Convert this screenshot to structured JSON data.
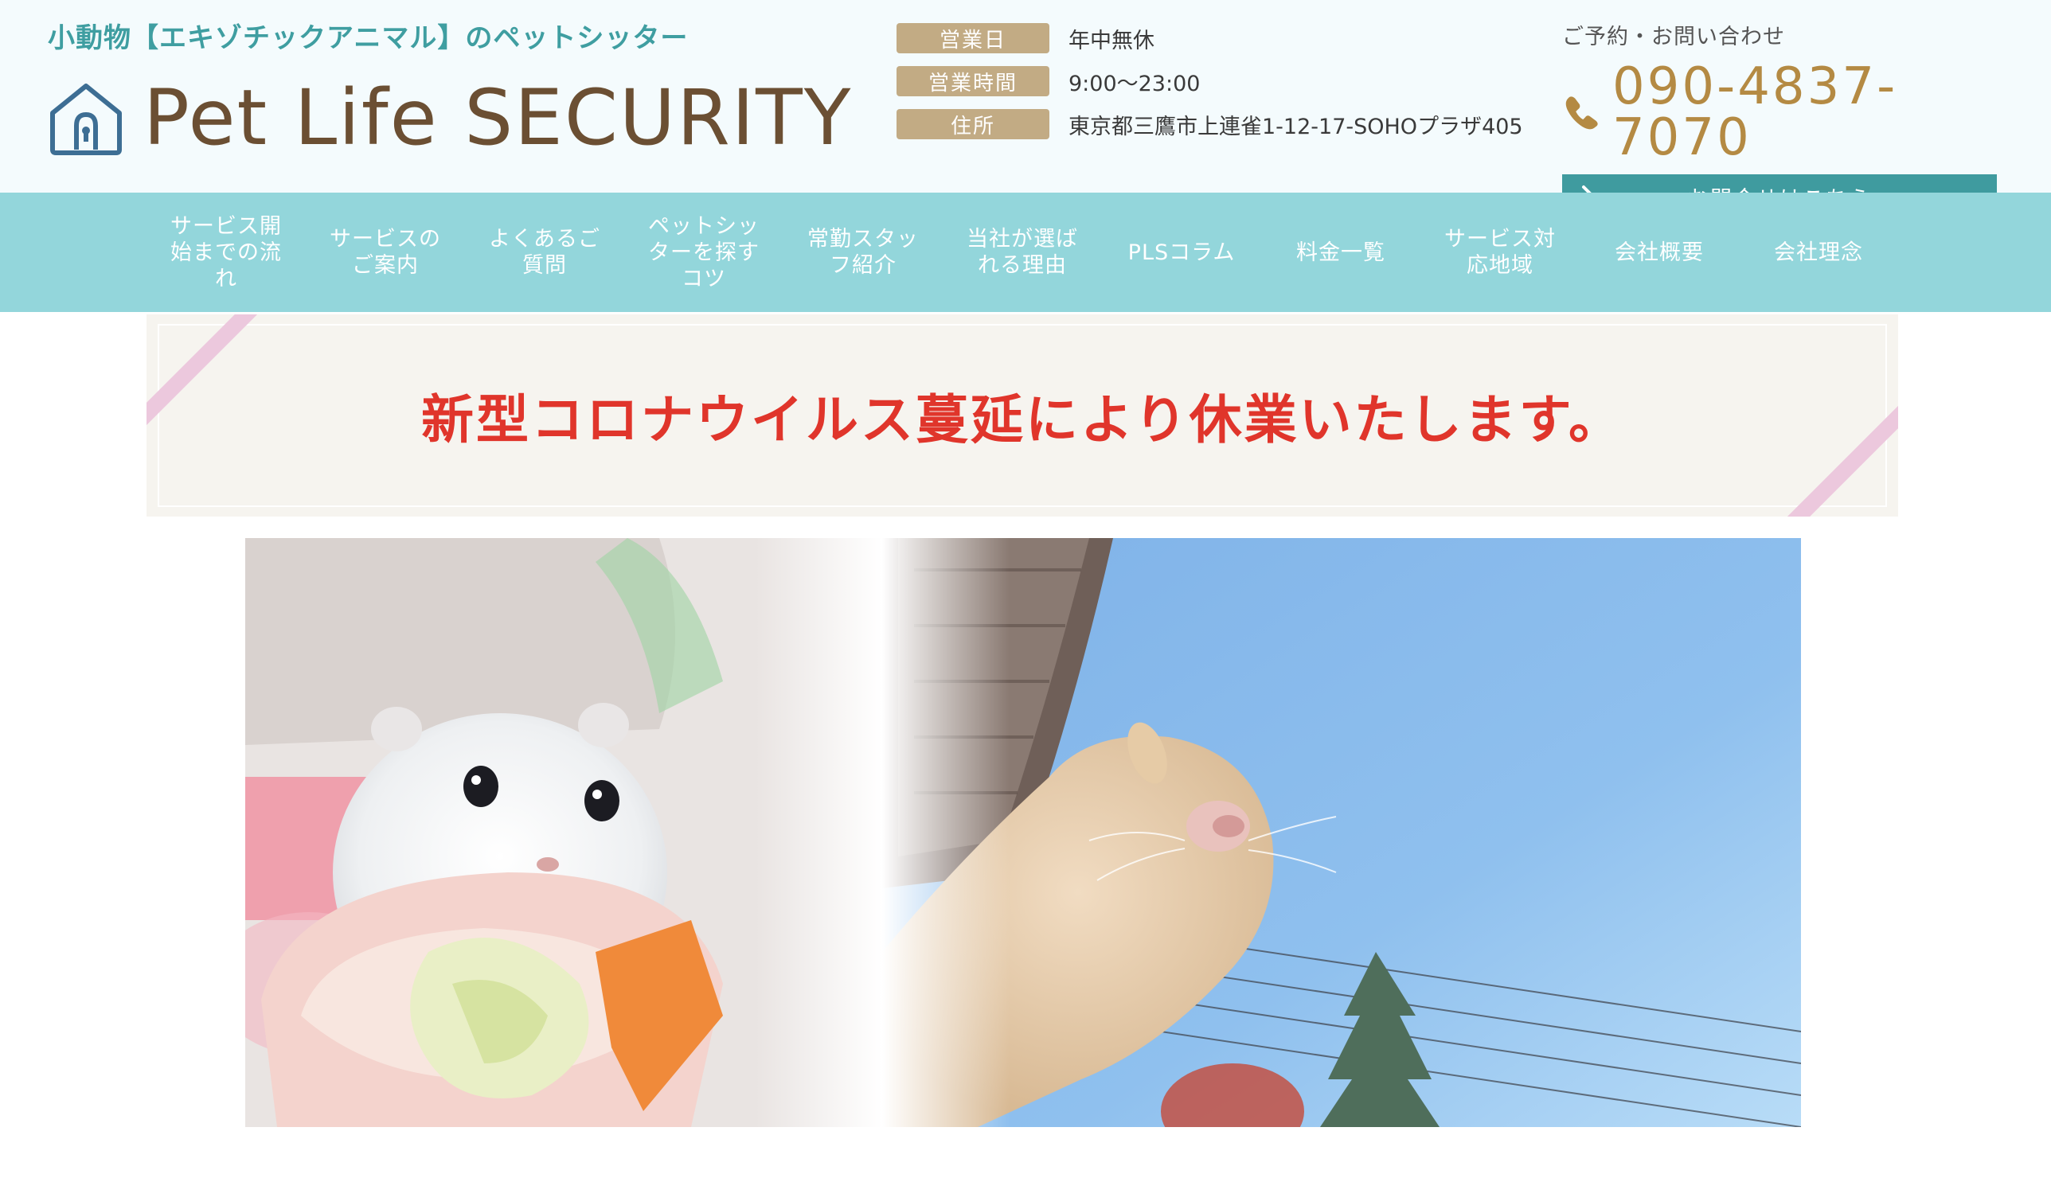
{
  "header": {
    "tagline": "小動物【エキゾチックアニマル】のペットシッター",
    "logo_text": "Pet Life SECURITY",
    "logo_icon": "house-lock-icon",
    "info": [
      {
        "label": "営業日",
        "value": "年中無休"
      },
      {
        "label": "営業時間",
        "value": "9:00〜23:00"
      },
      {
        "label": "住所",
        "value": "東京都三鷹市上連雀1-12-17-SOHOプラザ405"
      }
    ],
    "contact": {
      "title": "ご予約・お問い合わせ",
      "phone_icon": "phone-icon",
      "phone": "090-4837-7070",
      "button_label": "お問合せはこちら",
      "button_icon": "chevron-right-icon"
    }
  },
  "nav": {
    "items": [
      {
        "lines": [
          "サービス開",
          "始までの流",
          "れ"
        ]
      },
      {
        "lines": [
          "サービスの",
          "ご案内"
        ]
      },
      {
        "lines": [
          "よくあるご",
          "質問"
        ]
      },
      {
        "lines": [
          "ペットシッ",
          "ターを探す",
          "コツ"
        ]
      },
      {
        "lines": [
          "常勤スタッ",
          "フ紹介"
        ]
      },
      {
        "lines": [
          "当社が選ば",
          "れる理由"
        ]
      },
      {
        "lines": [
          "PLSコラム"
        ]
      },
      {
        "lines": [
          "料金一覧"
        ]
      },
      {
        "lines": [
          "サービス対",
          "応地域"
        ]
      },
      {
        "lines": [
          "会社概要"
        ]
      },
      {
        "lines": [
          "会社理念"
        ]
      }
    ]
  },
  "notice": {
    "text": "新型コロナウイルス蔓延により休業いたします。"
  },
  "colors": {
    "teal_text": "#3f9ea1",
    "brown_logo": "#6b4f33",
    "tan_label": "#c2ab84",
    "gold_phone": "#b48a43",
    "button_teal": "#3f9b9f",
    "nav_bg": "#93d6db",
    "notice_red": "#e0352b",
    "ribbon_pink": "#ecc8dd"
  }
}
